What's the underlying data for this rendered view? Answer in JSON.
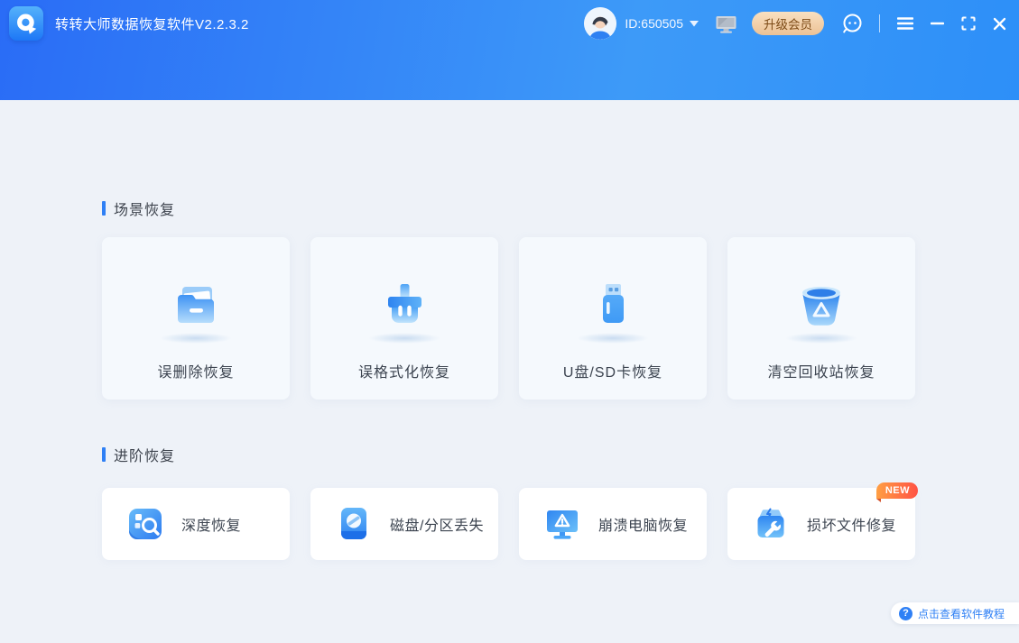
{
  "titlebar": {
    "app_title": "转转大师数据恢复软件V2.2.3.2",
    "user_id": "ID:650505",
    "upgrade_label": "升级会员"
  },
  "colors": {
    "accent_blue": "#2f80f5",
    "header_gradient_left": "#2a6cf6",
    "header_gradient_right": "#2d8ff8",
    "upgrade_bg_top": "#f9e0c0",
    "upgrade_bg_bottom": "#ecc296",
    "upgrade_text": "#7c4a16",
    "badge_gradient": [
      "#ff9f43",
      "#ff5244"
    ],
    "page_background": "#eef2f8",
    "scene_card_background": "#f5f9fd",
    "advanced_card_background": "#ffffff"
  },
  "sections": [
    {
      "title": "场景恢复",
      "cards": [
        {
          "label": "误删除恢复",
          "icon": "folder-icon"
        },
        {
          "label": "误格式化恢复",
          "icon": "format-brush-icon"
        },
        {
          "label": "U盘/SD卡恢复",
          "icon": "usb-drive-icon"
        },
        {
          "label": "清空回收站恢复",
          "icon": "recycle-bin-icon"
        }
      ]
    },
    {
      "title": "进阶恢复",
      "cards": [
        {
          "label": "深度恢复",
          "icon": "deep-scan-icon"
        },
        {
          "label": "磁盘/分区丢失",
          "icon": "disk-partition-icon"
        },
        {
          "label": "崩溃电脑恢复",
          "icon": "crashed-computer-icon"
        },
        {
          "label": "损坏文件修复",
          "icon": "file-repair-icon",
          "badge": "NEW"
        }
      ]
    }
  ],
  "tutorial": {
    "label": "点击查看软件教程",
    "question_mark": "?"
  }
}
